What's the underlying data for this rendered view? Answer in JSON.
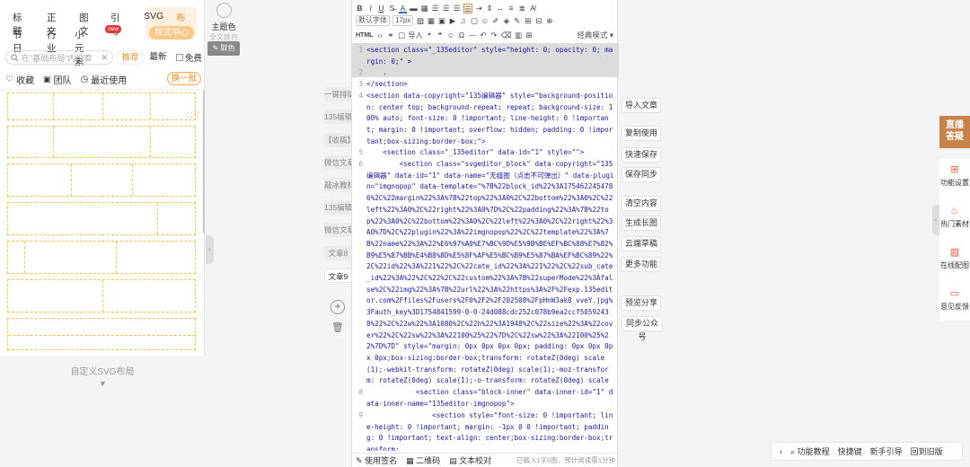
{
  "left": {
    "categories_row1": [
      "标题",
      "正文",
      "图文",
      "引导",
      "SVG",
      "布局"
    ],
    "categories_row2": [
      "节日",
      "行业",
      "小元素"
    ],
    "new_badge": "new",
    "style_center": "样式中心",
    "search_placeholder": "在\"基础布局\"内搜索",
    "pill_recommend": "推荐",
    "pill_latest": "最新",
    "free_label": "免费",
    "tab_favorites": "收藏",
    "tab_team": "团队",
    "tab_recent": "最近使用",
    "refresh": "换一批",
    "custom_svg": "自定义SVG布局"
  },
  "tools": {
    "theme_label": "主题色",
    "full_text_color": "全文换色",
    "pick_color": "取色",
    "side_buttons": [
      "一键排版",
      "135编辑",
      "【收稿】",
      "微信文章",
      "敲冰教材",
      "135编辑",
      "微信文章",
      "文章8",
      "文章9"
    ]
  },
  "toolbar": {
    "font_family": "默认字体",
    "font_size": "17px",
    "html": "HTML",
    "import": "导入",
    "classic_mode": "经典模式"
  },
  "code": {
    "line1": "<section class=\"_135editor\" style=\"height: 0; opacity: 0; margin: 0;\" >",
    "line2": "    .",
    "line3": "</section>",
    "line4a": "<section data-copyright=\"135编辑器\" style=\"background-position: center top; background-repeat: repeat; background-size: 100% auto; font-size: 0 !important; line-height: 0 !important; margin: 0 !important; overflow: hidden; padding: 0 !important;box-sizing:border-box;\">",
    "line5": "    <section class=\"_135editor\" data-id=\"1\" style=\"\">",
    "line6": "        <section class=\"svgeditor_block\" data-copyright=\"135编辑器\" data-id=\"1\" data-name=\"无缝图（点击不可弹出）\" data-plugin=\"imgnopop\" data-template=\"%7B%22block_id%22%3A1754622454786%2C%22margin%22%3A%7B%22top%22%3A0%2C%22bottom%22%3A0%2C%22left%22%3A0%2C%22right%22%3A0%7D%2C%22padding%22%3A%7B%22top%22%3A0%2C%22bottom%22%3A0%2C%22left%22%3A0%2C%22right%22%3A0%7D%2C%22plugin%22%3A%22imgnopop%22%2C%22template%22%3A%7B%22name%22%3A%22%E6%97%A0%E7%BC%9D%E5%9B%BE%EF%BC%88%E7%82%B9%E5%87%BB%E4%B8%8D%E5%8F%AF%E5%BC%B9%E5%87%BA%EF%BC%89%22%2C%22id%22%3A%221%22%2C%22cate_id%22%3A%221%22%2C%22sub_cate_id%22%3A%22%2C%22%2C%22custom%22%3A%7B%22superMode%22%3Afalse%2C%22img%22%3A%7B%22url%22%3A%22https%3A%2F%2Fexp.135editor.com%2Ffiles%2Fusers%2F0%2F2%2F202508%2FpHnW3ak8_vveY.jpg%3Fauth_key%3D1754841599-0-0-24d088cdc252c078b9ea2ccf50592438%22%2C%22w%22%3A1080%2C%22h%22%3A1948%2C%22size%22%3A%22cover%22%2C%22sw%22%3A%22100%25%22%7D%2C%22sw%22%3A%22100%25%22%7D%7D\" style=\"margin: 0px 0px 0px 0px; padding: 0px 0px 0px 0px;box-sizing:border-box;transform: rotateZ(0deg) scale(1);-webkit-transform: rotateZ(0deg) scale(1);-moz-transform: rotateZ(0deg) scale(1);-o-transform: rotateZ(0deg) scale(1);\">",
    "line8": "            <section class=\"block-inner\" data-inner-id=\"1\" data-inner-name=\"135editor-imgnopop\">",
    "line9": "                <section style=\"font-size: 0 !important; line-height: 0 !important; margin: -1px 0 0 !important; padding: 0 !important; text-align: center;box-sizing:border-box;transform:"
  },
  "editor_footer": {
    "sign": "使用签名",
    "qrcode": "二维码",
    "proofread": "文本校对",
    "count": "已输入1字0图，预计阅读需1分钟"
  },
  "actions": [
    "导入文章",
    "复制使用",
    "快速保存",
    "保存同步",
    "清空内容",
    "生成长图",
    "云端草稿",
    "更多功能",
    "预览分享",
    "同步公众号"
  ],
  "right_panel": {
    "live": "直播\n答疑",
    "items": [
      "功能设置",
      "热门素材",
      "在线配图",
      "意见反馈"
    ]
  },
  "bottom_bar": [
    "功能教程",
    "快捷键",
    "新手引导",
    "回到旧版"
  ]
}
